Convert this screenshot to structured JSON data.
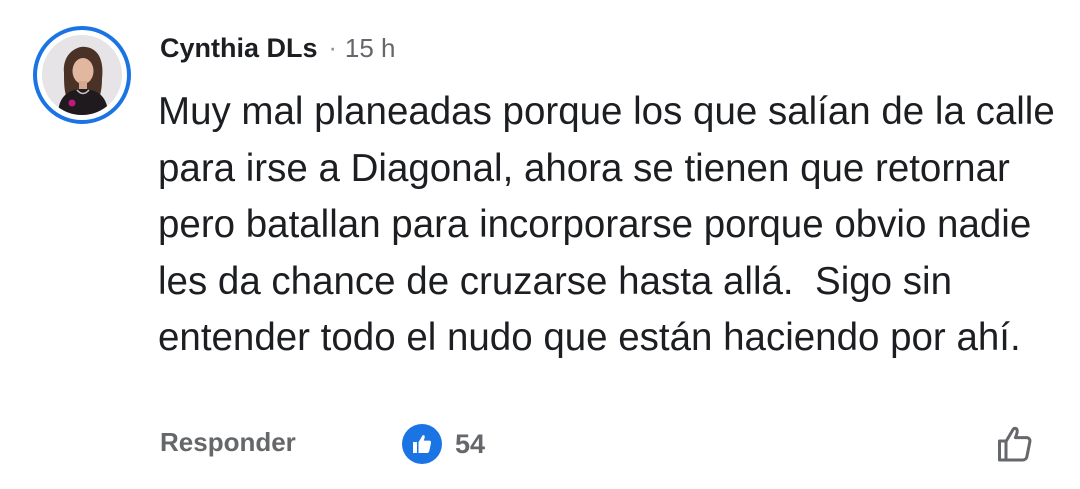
{
  "comment": {
    "author": "Cynthia DLs",
    "separator": "·",
    "time": "15 h",
    "text": "Muy mal planeadas porque los que salían de la calle para irse a Diagonal, ahora se tienen que retornar pero batallan para incorporarse porque obvio nadie les da chance de cruzarse hasta allá.  Sigo sin entender todo el nudo que están haciendo por ahí.",
    "avatar_icon": "profile-photo",
    "story_ring_color": "#1b74e4"
  },
  "actions": {
    "reply_label": "Responder",
    "reaction_icon": "thumbs-up-icon",
    "reaction_count": "54",
    "like_icon": "thumbs-up-outline-icon"
  },
  "colors": {
    "accent": "#1b74e4",
    "secondary_text": "#65676b",
    "primary_text": "#1c1e21"
  }
}
